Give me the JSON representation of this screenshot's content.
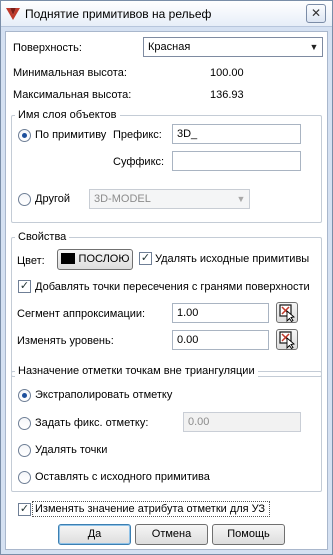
{
  "window": {
    "title": "Поднятие примитивов на рельеф",
    "close_glyph": "✕"
  },
  "surface": {
    "label": "Поверхность:",
    "value": "Красная"
  },
  "heights": {
    "min_label": "Минимальная высота:",
    "min_value": "100.00",
    "max_label": "Максимальная высота:",
    "max_value": "136.93"
  },
  "layer_group": {
    "title": "Имя слоя объектов",
    "by_primitive_label": "По примитиву",
    "prefix_label": "Префикс:",
    "prefix_value": "3D_",
    "suffix_label": "Суффикс:",
    "suffix_value": "",
    "other_label": "Другой",
    "other_value": "3D-MODEL"
  },
  "props_group": {
    "title": "Свойства",
    "color_label": "Цвет:",
    "color_button_label": "ПОСЛОЮ",
    "color_value": "#000000",
    "delete_source_label": "Удалять исходные примитивы",
    "add_points_label": "Добавлять точки пересечения с гранями поверхности",
    "segment_label": "Сегмент аппроксимации:",
    "segment_value": "1.00",
    "level_label": "Изменять уровень:",
    "level_value": "0.00"
  },
  "elev_group": {
    "title": "Назначение отметки точкам вне триангуляции",
    "options": [
      "Экстраполировать отметку",
      "Задать фикс. отметку:",
      "Удалять точки",
      "Оставлять с исходного примитива"
    ],
    "fixed_value": "0.00"
  },
  "attr_check_label": "Изменять значение атрибута отметки для УЗ",
  "buttons": {
    "ok": "Да",
    "cancel": "Отмена",
    "help": "Помощь"
  },
  "state": {
    "layer_mode": "by_primitive",
    "delete_source": true,
    "add_points": true,
    "elev_option_selected": 0,
    "change_attr": true
  },
  "icons": {
    "app": "app-logo-icon",
    "pick": "pick-point-icon",
    "dropdown": "chevron-down-icon"
  }
}
